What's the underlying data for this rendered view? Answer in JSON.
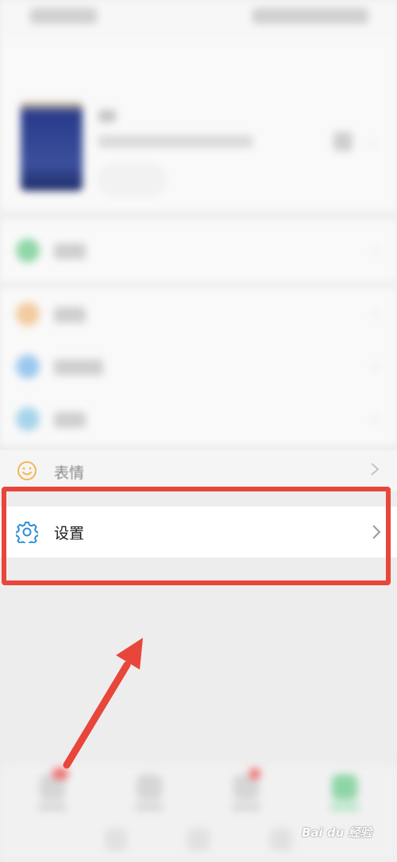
{
  "menu": {
    "sticker_label": "表情",
    "settings_label": "设置"
  },
  "colors": {
    "highlight": "#e8463b",
    "gear_blue": "#2f8fd6",
    "sticker_orange": "#f3b654",
    "chats_green": "#07c160"
  },
  "watermark": {
    "text": "Bai du 经验"
  }
}
